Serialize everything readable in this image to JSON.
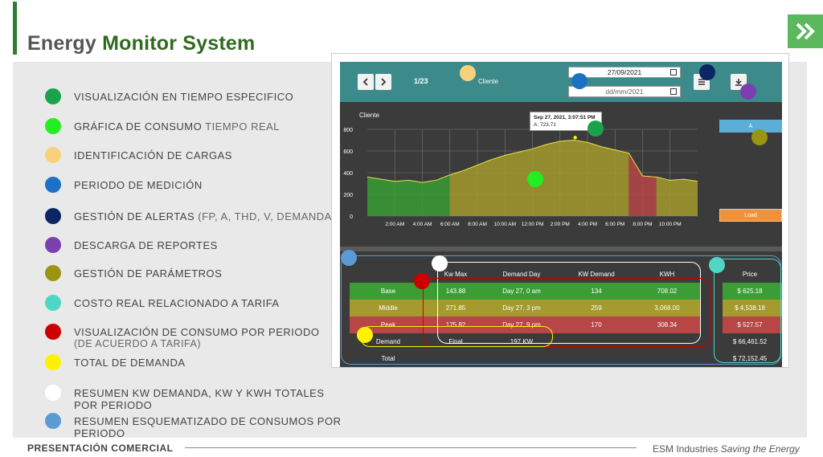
{
  "header": {
    "title_part1": "Energy",
    "title_part2": "Monitor System"
  },
  "legend": [
    {
      "color": "#1aa34a",
      "label": "VISUALIZACIÓN EN TIEMPO ESPECIFICO",
      "suffix": "",
      "line2": ""
    },
    {
      "color": "#22ee22",
      "label": "GRÁFICA DE CONSUMO",
      "suffix": " TIEMPO REAL",
      "line2": ""
    },
    {
      "color": "#f7d27a",
      "label": "IDENTIFICACIÓN DE CARGAS",
      "suffix": "",
      "line2": ""
    },
    {
      "color": "#1b72c4",
      "label": "PERIODO DE MEDICIÓN",
      "suffix": "",
      "line2": ""
    },
    {
      "color": "#0b2663",
      "label": "GESTIÓN DE ALERTAS",
      "suffix": " (FP, A, THD, V, DEMANDA)",
      "line2": ""
    },
    {
      "color": "#7b3fb0",
      "label": "DESCARGA DE REPORTES",
      "suffix": "",
      "line2": ""
    },
    {
      "color": "#9b9410",
      "label": "GESTIÓN DE PARÁMETROS",
      "suffix": "",
      "line2": ""
    },
    {
      "color": "#4fd6c4",
      "label": "COSTO REAL RELACIONADO A TARIFA",
      "suffix": "",
      "line2": ""
    },
    {
      "color": "#cc0000",
      "label": "VISUALIZACIÓN DE CONSUMO POR PERIODO",
      "suffix": "",
      "line2": "(DE ACUERDO A TARIFA)"
    },
    {
      "color": "#fff200",
      "label": "TOTAL DE DEMANDA",
      "suffix": "",
      "line2": ""
    },
    {
      "color": "#ffffff",
      "label": "RESUMEN KW DEMANDA, KW Y KWH TOTALES POR PERIODO",
      "suffix": "",
      "line2": ""
    },
    {
      "color": "#5b9bd5",
      "label": "RESUMEN ESQUEMATIZADO DE CONSUMOS POR PERIODO",
      "suffix": "",
      "line2": ""
    }
  ],
  "footer": {
    "left": "PRESENTACIÓN COMERCIAL",
    "company": "ESM Industries",
    "slogan": "Saving the Energy"
  },
  "app": {
    "page_counter": "1/23",
    "cliente_label": "Cliente",
    "date_from": "27/09/2021",
    "date_to_placeholder": "dd/mm/2021",
    "chart_title": "Cliente",
    "tooltip_line1": "Sep 27, 2021, 3:07:51 PM",
    "tooltip_line2": "A: 723.71",
    "btn_a": "A",
    "btn_load": "Load",
    "y_ticks": [
      "800",
      "600",
      "400",
      "200",
      "0"
    ],
    "x_ticks": [
      "2:00 AM",
      "4:00 AM",
      "6:00 AM",
      "8:00 AM",
      "10:00 AM",
      "12:00 PM",
      "2:00 PM",
      "4:00 PM",
      "6:00 PM",
      "8:00 PM",
      "10:00 PM"
    ]
  },
  "table": {
    "headers": [
      "",
      "Kw Max",
      "Demand Day",
      "KW Demand",
      "KWH",
      "Price"
    ],
    "rows": [
      {
        "name": "Base",
        "kwmax": "143.88",
        "day": "Day 27, 0 am",
        "kwdemand": "134",
        "kwh": "708.02",
        "price": "$ 625.18",
        "color": "#3a9e35"
      },
      {
        "name": "Middle",
        "kwmax": "271.85",
        "day": "Day 27, 3 pm",
        "kwdemand": "259",
        "kwh": "3,068.00",
        "price": "$ 4,538.18",
        "color": "#a49a2e"
      },
      {
        "name": "Peak",
        "kwmax": "175.82",
        "day": "Day 27, 9 pm",
        "kwdemand": "170",
        "kwh": "308.34",
        "price": "$ 527.57",
        "color": "#b84646"
      },
      {
        "name": "Demand",
        "kwmax": "Final",
        "day": "197 KW",
        "kwdemand": "",
        "kwh": "",
        "price": "$ 66,461.52",
        "color": "#3b3b3b"
      },
      {
        "name": "Total",
        "kwmax": "",
        "day": "",
        "kwdemand": "",
        "kwh": "",
        "price": "$ 72,152.45",
        "color": "#3b3b3b"
      }
    ]
  },
  "chart_data": {
    "type": "area",
    "title": "Cliente",
    "ylim": [
      0,
      800
    ],
    "x_hours": [
      0,
      1,
      2,
      3,
      4,
      5,
      6,
      7,
      8,
      9,
      10,
      11,
      12,
      13,
      14,
      15,
      16,
      17,
      18,
      19,
      20,
      21,
      22,
      23,
      24
    ],
    "values": [
      360,
      340,
      320,
      330,
      310,
      330,
      380,
      420,
      470,
      520,
      560,
      590,
      620,
      660,
      690,
      700,
      680,
      640,
      610,
      580,
      370,
      360,
      330,
      340,
      320
    ],
    "periods": [
      {
        "name": "Base",
        "from": 0,
        "to": 6,
        "color": "#3a9e35"
      },
      {
        "name": "Middle",
        "from": 6,
        "to": 19,
        "color": "#a49a2e"
      },
      {
        "name": "Peak",
        "from": 19,
        "to": 21,
        "color": "#b84646"
      },
      {
        "name": "Middle",
        "from": 21,
        "to": 24,
        "color": "#a49a2e"
      }
    ]
  },
  "colors": {
    "accent": "#2e7d32",
    "teal": "#3d8a8a"
  }
}
